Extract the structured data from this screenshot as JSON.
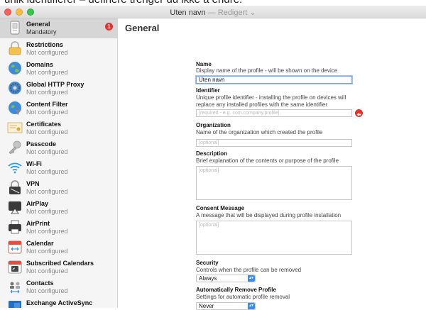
{
  "top_strip": {
    "text": "unik identifierer – definere trenger du ikke å endre."
  },
  "window": {
    "title": "Uten navn",
    "separator": " — ",
    "edited": "Redigert",
    "chevron": "⌄"
  },
  "colors": {
    "accent": "#3b8bf5",
    "error": "#e8302b",
    "selected_row": "#d6d6d6"
  },
  "sidebar": {
    "items": [
      {
        "name": "General",
        "status": "Mandatory",
        "icon": "general-profile-icon",
        "badge": "1"
      },
      {
        "name": "Restrictions",
        "status": "Not configured",
        "icon": "restrictions-icon"
      },
      {
        "name": "Domains",
        "status": "Not configured",
        "icon": "domains-globe-icon"
      },
      {
        "name": "Global HTTP Proxy",
        "status": "Not configured",
        "icon": "proxy-icon"
      },
      {
        "name": "Content Filter",
        "status": "Not configured",
        "icon": "content-filter-icon"
      },
      {
        "name": "Certificates",
        "status": "Not configured",
        "icon": "certificate-icon"
      },
      {
        "name": "Passcode",
        "status": "Not configured",
        "icon": "key-icon"
      },
      {
        "name": "Wi-Fi",
        "status": "Not configured",
        "icon": "wifi-icon"
      },
      {
        "name": "VPN",
        "status": "Not configured",
        "icon": "vpn-icon"
      },
      {
        "name": "AirPlay",
        "status": "Not configured",
        "icon": "airplay-icon"
      },
      {
        "name": "AirPrint",
        "status": "Not configured",
        "icon": "printer-icon"
      },
      {
        "name": "Calendar",
        "status": "Not configured",
        "icon": "calendar-icon"
      },
      {
        "name": "Subscribed Calendars",
        "status": "Not configured",
        "icon": "subscribed-calendar-icon"
      },
      {
        "name": "Contacts",
        "status": "Not configured",
        "icon": "contacts-icon"
      },
      {
        "name": "Exchange ActiveSync",
        "status": "",
        "icon": "exchange-icon"
      }
    ]
  },
  "main": {
    "title": "General",
    "name": {
      "label": "Name",
      "description": "Display name of the profile - will be shown on the device",
      "value": "Uten navn"
    },
    "identifier": {
      "label": "Identifier",
      "description": "Unique profile identifier - installing the profile on devices will replace any installed profiles with the same identifier",
      "placeholder": "[required - e.g. com.company.profile]"
    },
    "organization": {
      "label": "Organization",
      "description": "Name of the organization which created the profile",
      "placeholder": "[optional]"
    },
    "description": {
      "label": "Description",
      "description": "Brief explanation of the contents or purpose of the profile",
      "placeholder": "[optional]"
    },
    "consent": {
      "label": "Consent Message",
      "description": "A message that will be displayed during profile installation",
      "placeholder": "[optional]"
    },
    "security": {
      "label": "Security",
      "description": "Controls when the profile can be removed",
      "value": "Always"
    },
    "auto_remove": {
      "label": "Automatically Remove Profile",
      "description": "Settings for automatic profile removal",
      "value": "Never"
    }
  }
}
